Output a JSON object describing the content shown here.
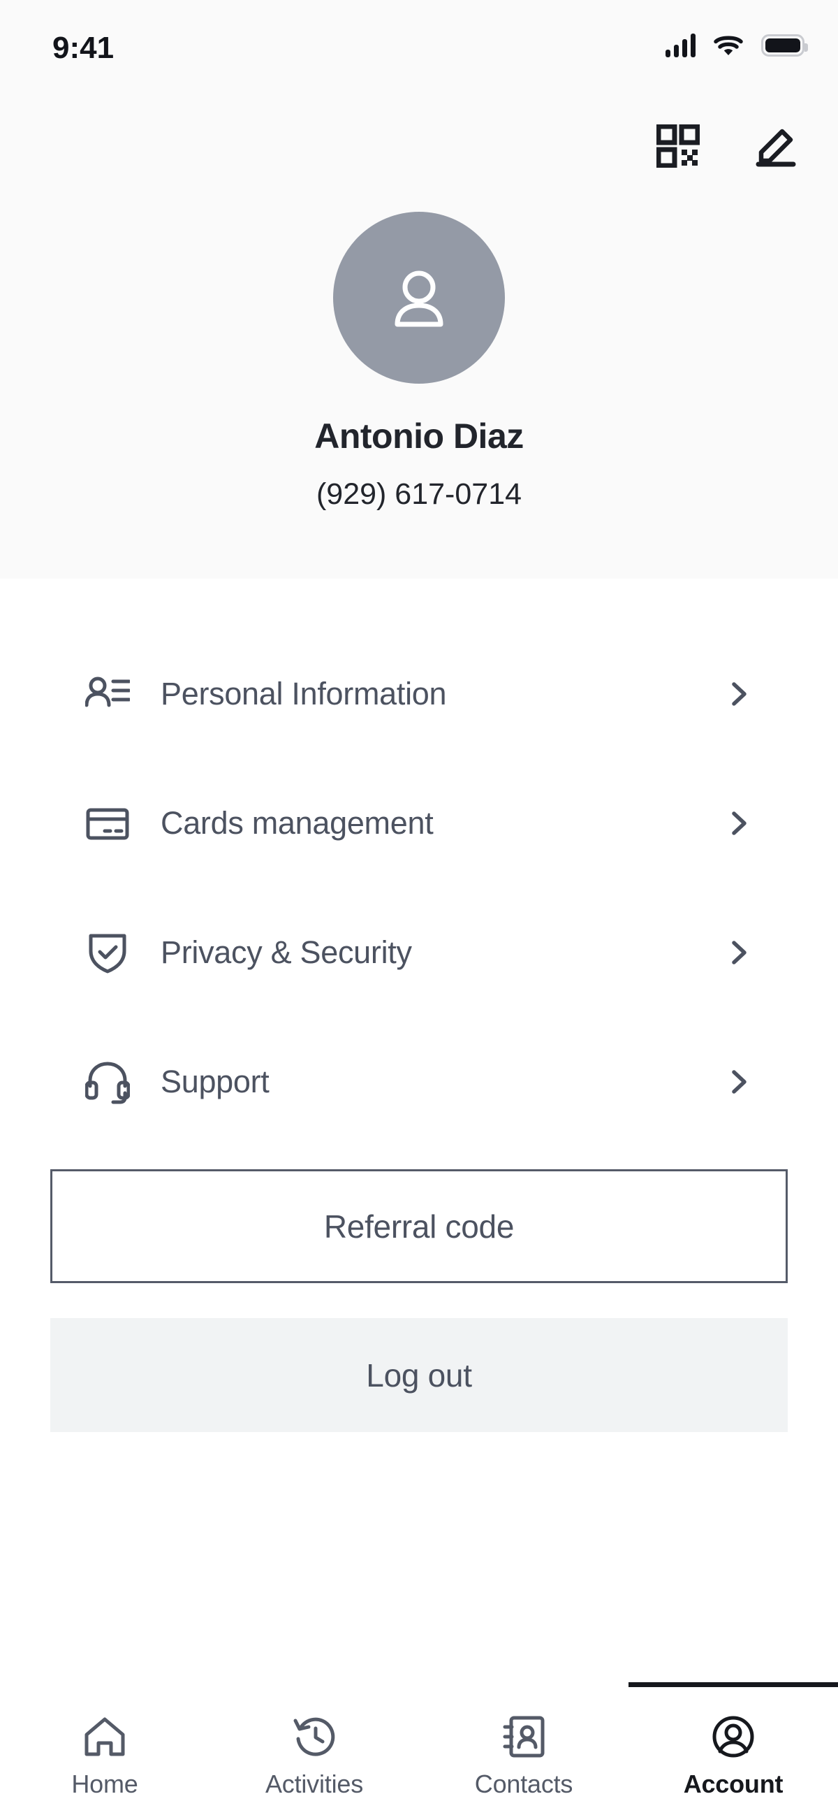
{
  "status_bar": {
    "time": "9:41",
    "signal_icon": "cellular-signal-icon",
    "wifi_icon": "wifi-icon",
    "battery_icon": "battery-full-icon"
  },
  "header": {
    "qr_icon": "qr-code-icon",
    "edit_icon": "pencil-edit-icon",
    "avatar_icon": "user-avatar-icon",
    "avatar_bg": "#949AA6",
    "name": "Antonio Diaz",
    "phone": "(929) 617-0714",
    "background": "#FAFAFA"
  },
  "menu": {
    "items": [
      {
        "label": "Personal Information",
        "icon": "contact-person-list-icon",
        "chevron": "chevron-right-icon"
      },
      {
        "label": "Cards management",
        "icon": "credit-card-icon",
        "chevron": "chevron-right-icon"
      },
      {
        "label": "Privacy & Security",
        "icon": "shield-check-icon",
        "chevron": "chevron-right-icon"
      },
      {
        "label": "Support",
        "icon": "headset-icon",
        "chevron": "chevron-right-icon"
      }
    ]
  },
  "actions": {
    "referral_label": "Referral code",
    "logout_label": "Log out",
    "logout_bg": "#F1F3F4",
    "referral_border": "#555B69"
  },
  "tabbar": {
    "tabs": [
      {
        "label": "Home",
        "icon": "home-icon",
        "active": false
      },
      {
        "label": "Activities",
        "icon": "history-clock-icon",
        "active": false
      },
      {
        "label": "Contacts",
        "icon": "address-book-icon",
        "active": false
      },
      {
        "label": "Account",
        "icon": "user-circle-icon",
        "active": true
      }
    ],
    "active_indicator_color": "#16181D"
  },
  "colors": {
    "text_primary": "#22252C",
    "text_secondary": "#4C5260",
    "icon_stroke": "#4C5260",
    "surface": "#FFFFFF"
  }
}
